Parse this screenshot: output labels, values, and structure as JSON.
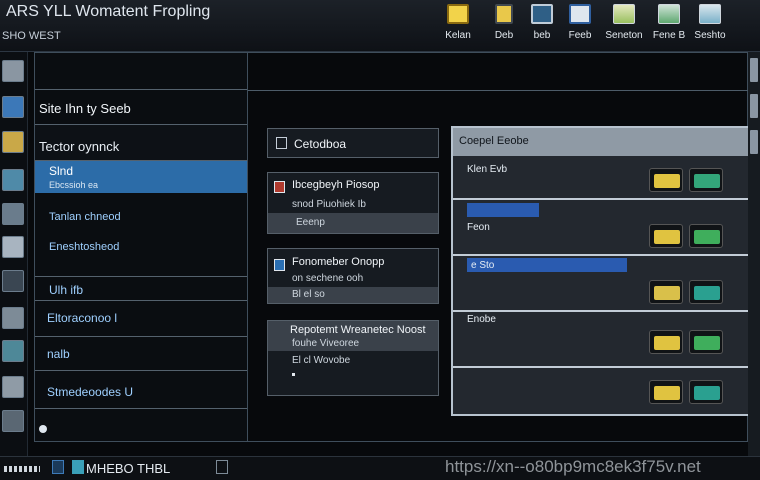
{
  "window": {
    "title": "ARS YLL Womatent Fropling",
    "subtitle": "SHO WEST"
  },
  "toolbar": {
    "buttons": [
      {
        "label": "Kelan",
        "icon": "folder-icon"
      },
      {
        "label": "Deb",
        "icon": "file-icon"
      },
      {
        "label": "beb",
        "icon": "web-icon"
      },
      {
        "label": "Feeb",
        "icon": "document-icon"
      },
      {
        "label": "Seneton",
        "icon": "chart-icon"
      },
      {
        "label": "Fene B",
        "icon": "panel-icon"
      },
      {
        "label": "Seshto",
        "icon": "table-icon"
      }
    ]
  },
  "left_panel": {
    "header": "Site Ihn ty Seeb",
    "section_title": "Tector oynnck",
    "items": [
      {
        "label": "Slnd",
        "sub": "Ebcssioh ea",
        "selected": true
      },
      {
        "label": "Tanlan chneod",
        "sub": ""
      },
      {
        "label": "Eneshtosheod",
        "sub": ""
      },
      {
        "label": "Ulh ifb",
        "sub": ""
      },
      {
        "label": "Eltoraconoo l",
        "sub": ""
      },
      {
        "label": "nalb",
        "sub": ""
      },
      {
        "label": "Stmedeoodes U",
        "sub": ""
      }
    ]
  },
  "middle": {
    "cards": [
      {
        "title": "Cetodboa",
        "lines": []
      },
      {
        "title": "Ibcegbeyh Piosop",
        "lines": [
          "snod Piuohiek Ib",
          "Eeenp"
        ]
      },
      {
        "title": "Fonomeber Onopp",
        "lines": [
          "on sechene ooh",
          "Bl el so"
        ]
      },
      {
        "title": "Repotemt Wreanetec Noost",
        "lines": [
          "fouhe Viveoree",
          "El cl Wovobe"
        ]
      }
    ]
  },
  "right_panel": {
    "title": "Coepel Eeobe",
    "rows": [
      {
        "label": "Klen Evb",
        "bar_color": "#2a5bb0",
        "bar_fill": 0.0
      },
      {
        "label": "Feon",
        "bar_color": "#2a5bb0",
        "bar_fill": 0.24
      },
      {
        "label": "e Sto",
        "bar_color": "#2a5bb0",
        "bar_fill": 0.57
      },
      {
        "label": "Enobe",
        "bar_color": "#2a5bb0",
        "bar_fill": 0.0
      }
    ]
  },
  "taskbar": {
    "label": "MHEBO THBL",
    "watermark": "https://xn--o80bp9mc8ek3f75v.net"
  },
  "colors": {
    "accent": "#2a6fb3",
    "selection": "#2e6da4",
    "panel_border": "#b7c3cf"
  }
}
